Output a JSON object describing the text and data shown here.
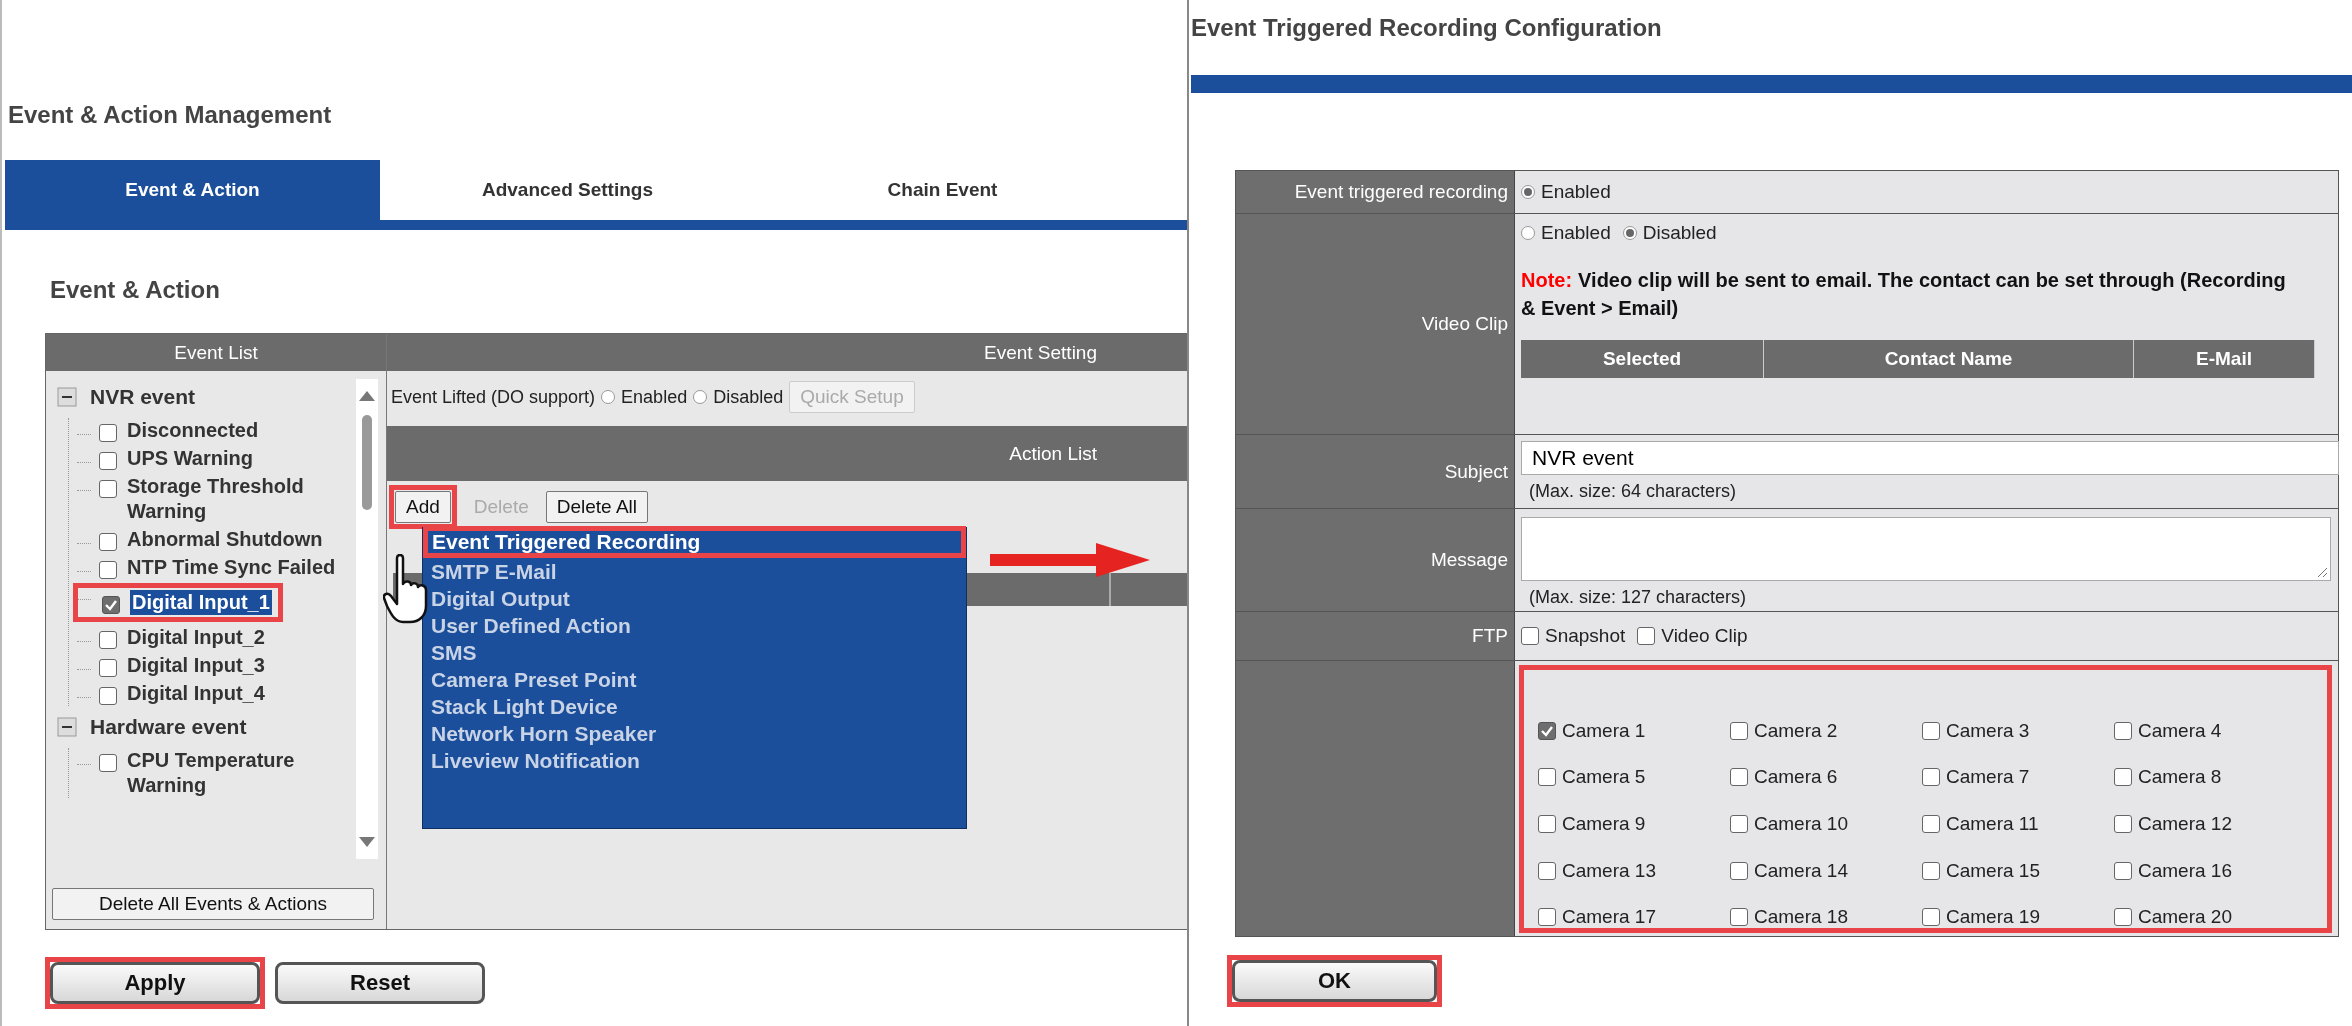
{
  "event_action_window": {
    "title": "Event & Action Management",
    "tabs": [
      {
        "label": "Event & Action",
        "selected": true
      },
      {
        "label": "Advanced Settings",
        "selected": false
      },
      {
        "label": "Chain Event",
        "selected": false
      }
    ],
    "section_title": "Event & Action",
    "event_list": {
      "header": "Event List",
      "groups": [
        {
          "label": "NVR event",
          "expanded": true,
          "children": [
            {
              "label": "Disconnected",
              "checked": false,
              "selected": false,
              "highlighted": false
            },
            {
              "label": "UPS Warning",
              "checked": false,
              "selected": false,
              "highlighted": false
            },
            {
              "label": "Storage Threshold Warning",
              "checked": false,
              "selected": false,
              "highlighted": false
            },
            {
              "label": "Abnormal Shutdown",
              "checked": false,
              "selected": false,
              "highlighted": false
            },
            {
              "label": "NTP Time Sync Failed",
              "checked": false,
              "selected": false,
              "highlighted": false
            },
            {
              "label": "Digital Input_1",
              "checked": true,
              "selected": true,
              "highlighted": true
            },
            {
              "label": "Digital Input_2",
              "checked": false,
              "selected": false,
              "highlighted": false
            },
            {
              "label": "Digital Input_3",
              "checked": false,
              "selected": false,
              "highlighted": false
            },
            {
              "label": "Digital Input_4",
              "checked": false,
              "selected": false,
              "highlighted": false
            }
          ]
        },
        {
          "label": "Hardware event",
          "expanded": true,
          "children": [
            {
              "label": "CPU Temperature Warning",
              "checked": false,
              "selected": false,
              "highlighted": false
            }
          ]
        }
      ],
      "button": "Delete All Events & Actions"
    },
    "event_setting": {
      "header": "Event Setting",
      "event_lifted": {
        "label": "Event Lifted (DO support)",
        "options": [
          {
            "label": "Enabled",
            "selected": false
          },
          {
            "label": "Disabled",
            "selected": false
          }
        ],
        "button": {
          "label": "Quick Setup",
          "disabled": true
        }
      },
      "action_list": {
        "header": "Action List",
        "buttons": [
          {
            "label": "Add",
            "disabled": false,
            "highlighted": true
          },
          {
            "label": "Delete",
            "disabled": true,
            "highlighted": false
          },
          {
            "label": "Delete All",
            "disabled": false,
            "highlighted": false
          }
        ],
        "dropdown": [
          {
            "label": "Event Triggered Recording",
            "selected": true,
            "highlighted": true
          },
          {
            "label": "SMTP E-Mail",
            "selected": false,
            "highlighted": false
          },
          {
            "label": "Digital Output",
            "selected": false,
            "highlighted": false
          },
          {
            "label": "User Defined Action",
            "selected": false,
            "highlighted": false
          },
          {
            "label": "SMS",
            "selected": false,
            "highlighted": false
          },
          {
            "label": "Camera Preset Point",
            "selected": false,
            "highlighted": false
          },
          {
            "label": "Stack Light Device",
            "selected": false,
            "highlighted": false
          },
          {
            "label": "Network Horn Speaker",
            "selected": false,
            "highlighted": false
          },
          {
            "label": "Liveview Notification",
            "selected": false,
            "highlighted": false
          }
        ]
      }
    },
    "buttons": [
      {
        "label": "Apply",
        "highlighted": true
      },
      {
        "label": "Reset",
        "highlighted": false
      }
    ]
  },
  "recording_config_window": {
    "title": "Event Triggered Recording Configuration",
    "event_triggered_recording": {
      "label": "Event triggered recording",
      "options": [
        {
          "label": "Enabled",
          "selected": true
        }
      ]
    },
    "video_clip": {
      "label": "Video Clip",
      "options": [
        {
          "label": "Enabled",
          "selected": false
        },
        {
          "label": "Disabled",
          "selected": true
        }
      ],
      "note_label": "Note:",
      "note": "Video clip will be sent to email. The contact can be set through (Recording & Event > Email)",
      "contacts_columns": [
        "Selected",
        "Contact Name",
        "E-Mail"
      ]
    },
    "subject": {
      "label": "Subject",
      "value": "NVR event",
      "hint": "(Max. size: 64 characters)"
    },
    "message": {
      "label": "Message",
      "hint": "(Max. size: 127 characters)"
    },
    "ftp": {
      "label": "FTP",
      "options": [
        {
          "label": "Snapshot",
          "checked": false
        },
        {
          "label": "Video Clip",
          "checked": false
        }
      ]
    },
    "cameras_highlighted": true,
    "cameras": [
      {
        "label": "Camera 1",
        "checked": true
      },
      {
        "label": "Camera 2",
        "checked": false
      },
      {
        "label": "Camera 3",
        "checked": false
      },
      {
        "label": "Camera 4",
        "checked": false
      },
      {
        "label": "Camera 5",
        "checked": false
      },
      {
        "label": "Camera 6",
        "checked": false
      },
      {
        "label": "Camera 7",
        "checked": false
      },
      {
        "label": "Camera 8",
        "checked": false
      },
      {
        "label": "Camera 9",
        "checked": false
      },
      {
        "label": "Camera 10",
        "checked": false
      },
      {
        "label": "Camera 11",
        "checked": false
      },
      {
        "label": "Camera 12",
        "checked": false
      },
      {
        "label": "Camera 13",
        "checked": false
      },
      {
        "label": "Camera 14",
        "checked": false
      },
      {
        "label": "Camera 15",
        "checked": false
      },
      {
        "label": "Camera 16",
        "checked": false
      },
      {
        "label": "Camera 17",
        "checked": false
      },
      {
        "label": "Camera 18",
        "checked": false
      },
      {
        "label": "Camera 19",
        "checked": false
      },
      {
        "label": "Camera 20",
        "checked": false
      }
    ],
    "ok_button": {
      "label": "OK",
      "highlighted": true
    }
  }
}
